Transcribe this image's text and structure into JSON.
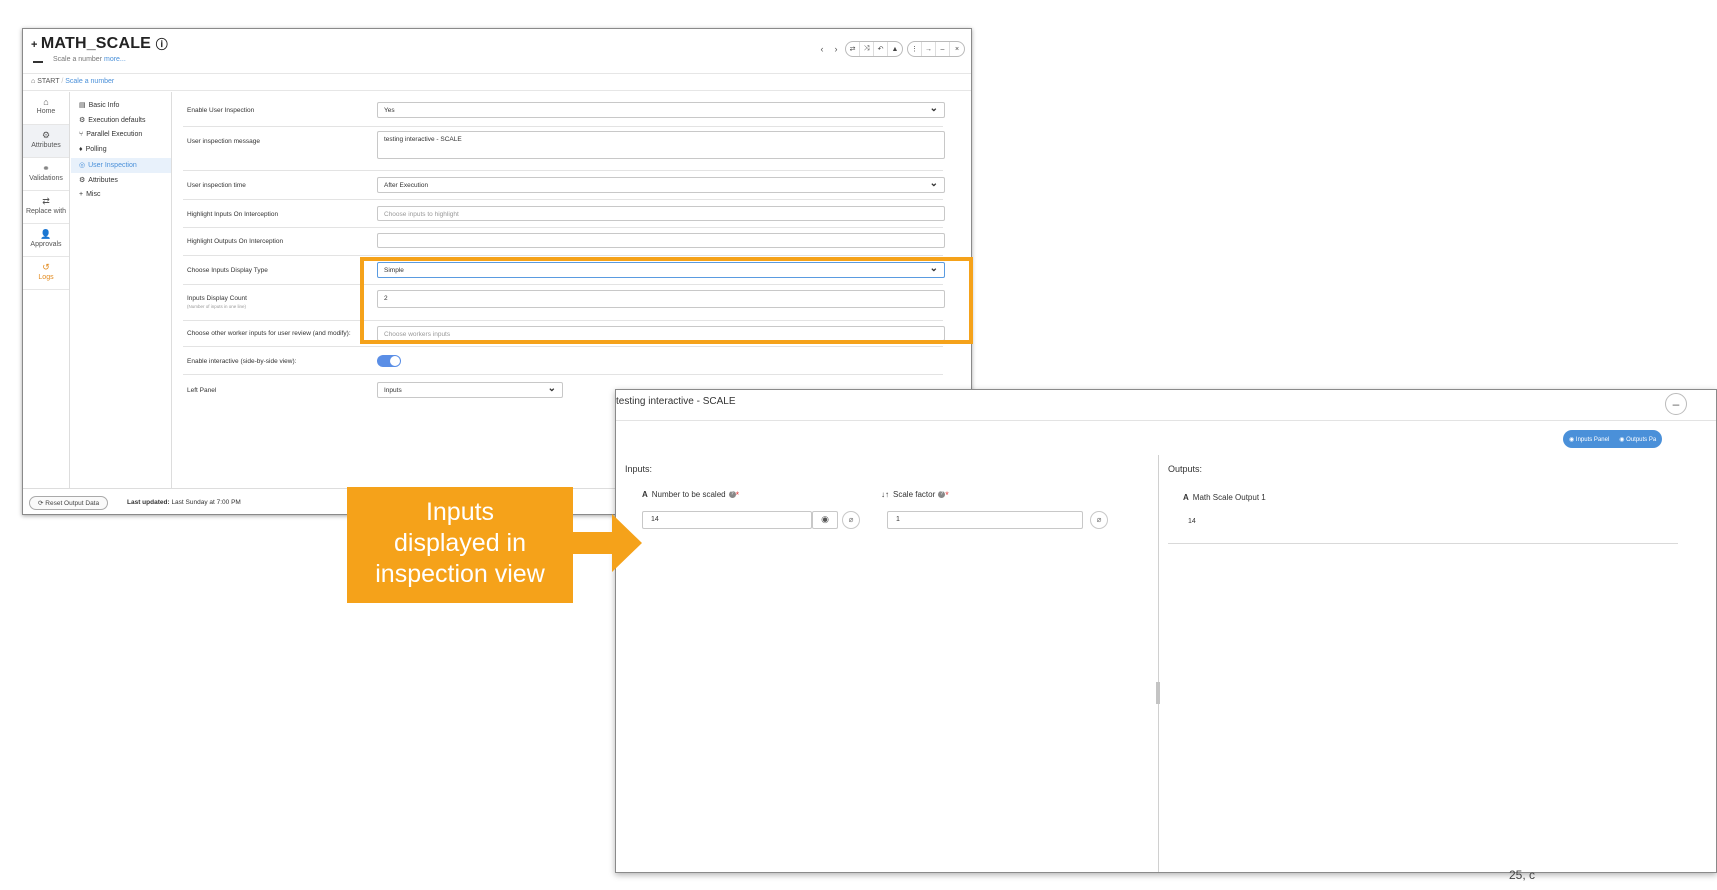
{
  "main_window": {
    "title": "MATH_SCALE",
    "subtitle": "Scale a number",
    "subtitle_more": "more...",
    "nav_prev": "‹",
    "nav_next": "›",
    "breadcrumb": {
      "root": "START",
      "separator": "/",
      "current": "Scale a number"
    },
    "rail": [
      {
        "label": "Home",
        "icon": "home-icon"
      },
      {
        "label": "Attributes",
        "icon": "gear-icon"
      },
      {
        "label": "Validations",
        "icon": "link-icon"
      },
      {
        "label": "Replace with",
        "icon": "swap-icon"
      },
      {
        "label": "Approvals",
        "icon": "user-icon"
      },
      {
        "label": "Logs",
        "icon": "history-icon"
      }
    ],
    "sub_nav": [
      {
        "label": "Basic Info"
      },
      {
        "label": "Execution defaults"
      },
      {
        "label": "Parallel Execution"
      },
      {
        "label": "Polling"
      },
      {
        "label": "User Inspection"
      },
      {
        "label": "Attributes"
      },
      {
        "label": "Misc"
      }
    ],
    "form": {
      "enable_user_inspection": {
        "label": "Enable User Inspection",
        "value": "Yes"
      },
      "user_inspection_message": {
        "label": "User inspection message",
        "value": "testing interactive - SCALE"
      },
      "user_inspection_time": {
        "label": "User inspection time",
        "value": "After Execution"
      },
      "highlight_inputs": {
        "label": "Highlight Inputs On Interception",
        "placeholder": "Choose inputs to highlight"
      },
      "highlight_outputs": {
        "label": "Highlight Outputs On Interception",
        "placeholder": ""
      },
      "inputs_display_type": {
        "label": "Choose Inputs Display Type",
        "value": "Simple"
      },
      "inputs_display_count": {
        "label": "Inputs Display Count",
        "sublabel": "(Number of inputs in one line)",
        "value": "2"
      },
      "other_worker_inputs": {
        "label": "Choose other worker inputs for user review (and modify):",
        "placeholder": "Choose workers inputs"
      },
      "enable_interactive": {
        "label": "Enable interactive (side-by-side view):",
        "enabled": true
      },
      "left_panel": {
        "label": "Left Panel",
        "value": "Inputs"
      }
    },
    "footer": {
      "reset_button": "Reset Output Data",
      "last_updated_label": "Last updated:",
      "last_updated_value": "Last Sunday at 7:00 PM"
    }
  },
  "callout": {
    "line1": "Inputs",
    "line2": "displayed in",
    "line3": "inspection view"
  },
  "dialog": {
    "title": "testing interactive - SCALE",
    "close_label": "–",
    "panel_toggle": {
      "inputs": "Inputs Panel",
      "outputs": "Outputs Pa"
    },
    "inputs_header": "Inputs:",
    "outputs_header": "Outputs:",
    "inputs": [
      {
        "type_tag": "A",
        "name": "Number to be scaled",
        "value": "14"
      },
      {
        "type_tag": "↓↑",
        "name": "Scale factor",
        "value": "1"
      }
    ],
    "outputs": [
      {
        "type_tag": "A",
        "name": "Math Scale Output 1",
        "value": "14"
      }
    ]
  },
  "footer_copyright": "25, c",
  "colors": {
    "accent_orange": "#f5a21a",
    "accent_blue": "#4a90d9"
  }
}
